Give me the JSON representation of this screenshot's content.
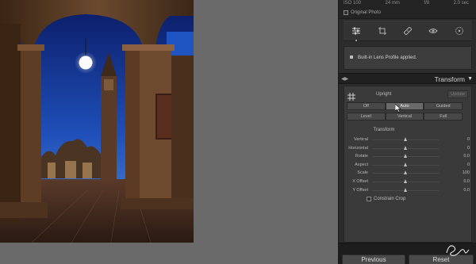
{
  "info": {
    "iso": "ISO 100",
    "focal": "24 mm",
    "aperture": "f/8",
    "shutter": "2.0 sec",
    "original_photo_label": "Original Photo"
  },
  "tools": [
    {
      "icon": "sliders-icon",
      "active": true
    },
    {
      "icon": "crop-rotate-icon",
      "active": false
    },
    {
      "icon": "healing-brush-icon",
      "active": false
    },
    {
      "icon": "red-eye-icon",
      "active": false
    },
    {
      "icon": "radial-filter-icon",
      "active": false
    }
  ],
  "lens_profile": {
    "message": "Built-in Lens Profile applied."
  },
  "transform": {
    "title": "Transform",
    "upright_label": "Upright",
    "update_label": "Update",
    "mode_row1": [
      "Off",
      "Auto",
      "Guided"
    ],
    "mode_row2": [
      "Level",
      "Vertical",
      "Full"
    ],
    "sub_title": "Transform",
    "sliders": [
      {
        "label": "Vertical",
        "value": "0",
        "pos": 0.5
      },
      {
        "label": "Horizontal",
        "value": "0",
        "pos": 0.5
      },
      {
        "label": "Rotate",
        "value": "0.0",
        "pos": 0.5
      },
      {
        "label": "Aspect",
        "value": "0",
        "pos": 0.5
      },
      {
        "label": "Scale",
        "value": "100",
        "pos": 0.5
      },
      {
        "label": "X Offset",
        "value": "0.0",
        "pos": 0.5
      },
      {
        "label": "Y Offset",
        "value": "0.0",
        "pos": 0.5
      }
    ],
    "constrain_crop_label": "Constrain Crop"
  },
  "footer": {
    "previous_label": "Previous",
    "reset_label": "Reset"
  },
  "colors": {
    "panel_bg": "#2c2c2c",
    "viewport_bg": "#6a6a6a",
    "sky_top": "#0b1c66",
    "sky_bottom": "#2f6ed6"
  }
}
